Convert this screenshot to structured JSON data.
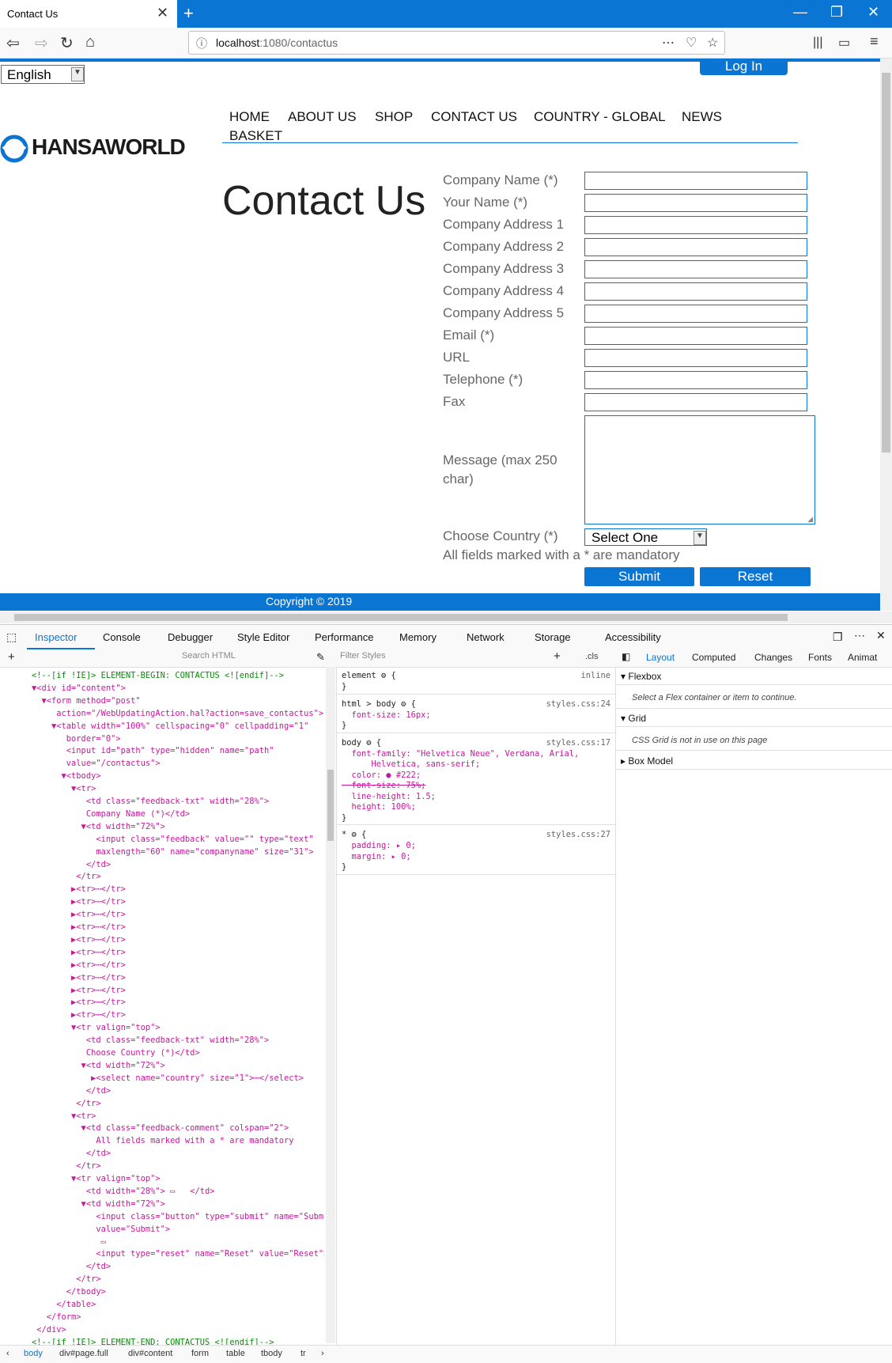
{
  "browser": {
    "tab_title": "Contact Us",
    "close_glyph": "✕",
    "new_tab_glyph": "+",
    "url_host": "localhost",
    "url_path": ":1080/contactus",
    "window_controls": [
      "—",
      "❐",
      "✕"
    ]
  },
  "page": {
    "language": "English",
    "login_label": "Log In",
    "logo_text": "HANSAWORLD",
    "menu": [
      "HOME",
      "ABOUT US",
      "SHOP",
      "CONTACT US",
      "COUNTRY - GLOBAL",
      "NEWS",
      "BASKET"
    ],
    "title": "Contact Us",
    "fields": [
      "Company Name (*)",
      "Your Name (*)",
      "Company Address 1",
      "Company Address 2",
      "Company Address 3",
      "Company Address 4",
      "Company Address 5",
      "Email (*)",
      "URL",
      "Telephone (*)",
      "Fax"
    ],
    "message_label_1": "Message (max 250",
    "message_label_2": "char)",
    "country_label": "Choose Country (*)",
    "country_value": "Select One",
    "mandatory_note": "All fields marked with a * are mandatory",
    "submit_label": "Submit",
    "reset_label": "Reset",
    "copyright": "Copyright © 2019",
    "accent_color": "#0a75d2"
  },
  "devtools": {
    "tabs": [
      "Inspector",
      "Console",
      "Debugger",
      "Style Editor",
      "Performance",
      "Memory",
      "Network",
      "Storage",
      "Accessibility"
    ],
    "search_html_placeholder": "Search HTML",
    "filter_styles_placeholder": "Filter Styles",
    "cls_label": ".cls",
    "layout_tabs": [
      "Layout",
      "Computed",
      "Changes",
      "Fonts",
      "Animat"
    ],
    "flexbox_heading": "Flexbox",
    "flexbox_note": "Select a Flex container or item to continue.",
    "grid_heading": "Grid",
    "grid_note": "CSS Grid is not in use on this page",
    "box_model_heading": "Box Model",
    "breadcrumb": [
      "body",
      "div#page.full",
      "div#content",
      "form",
      "table",
      "tbody",
      "tr"
    ],
    "markup_lines": [
      "<!--[if !IE]> ELEMENT-BEGIN: CONTACTUS <![endif]-->",
      "▼<div id=\"content\">",
      "  ▼<form method=\"post\"",
      "     action=\"/WebUpdatingAction.hal?action=save_contactus\">",
      "    ▼<table width=\"100%\" cellspacing=\"0\" cellpadding=\"1\"",
      "       border=\"0\">",
      "       <input id=\"path\" type=\"hidden\" name=\"path\"",
      "       value=\"/contactus\">",
      "      ▼<tbody>",
      "        ▼<tr>",
      "           <td class=\"feedback-txt\" width=\"28%\">",
      "           Company Name (*)</td>",
      "          ▼<td width=\"72%\">",
      "             <input class=\"feedback\" value=\"\" type=\"text\"",
      "             maxlength=\"60\" name=\"companyname\" size=\"31\">",
      "           </td>",
      "         </tr>",
      "        ▶<tr>⋯</tr>",
      "        ▶<tr>⋯</tr>",
      "        ▶<tr>⋯</tr>",
      "        ▶<tr>⋯</tr>",
      "        ▶<tr>⋯</tr>",
      "        ▶<tr>⋯</tr>",
      "        ▶<tr>⋯</tr>",
      "        ▶<tr>⋯</tr>",
      "        ▶<tr>⋯</tr>",
      "        ▶<tr>⋯</tr>",
      "        ▶<tr>⋯</tr>",
      "        ▼<tr valign=\"top\">",
      "           <td class=\"feedback-txt\" width=\"28%\">",
      "           Choose Country (*)</td>",
      "          ▼<td width=\"72%\">",
      "            ▶<select name=\"country\" size=\"1\">⋯</select>",
      "           </td>",
      "         </tr>",
      "        ▼<tr>",
      "          ▼<td class=\"feedback-comment\" colspan=\"2\">",
      "             All fields marked with a * are mandatory",
      "           </td>",
      "         </tr>",
      "        ▼<tr valign=\"top\">",
      "           <td width=\"28%\"> ▭   </td>",
      "          ▼<td width=\"72%\">",
      "             <input class=\"button\" type=\"submit\" name=\"Submit\"",
      "             value=\"Submit\">",
      "              ▭",
      "             <input type=\"reset\" name=\"Reset\" value=\"Reset\">",
      "           </td>",
      "         </tr>",
      "       </tbody>",
      "     </table>",
      "   </form>",
      " </div>",
      "<!--[if !IE]> ELEMENT-END: CONTACTUS <![endif]-->"
    ],
    "rules": [
      {
        "selector": "element ⚙ {",
        "source": "inline",
        "lines": [
          "}"
        ]
      },
      {
        "selector": "html > body ⚙ {",
        "source": "styles.css:24",
        "lines": [
          "  font-size: 16px;",
          "}"
        ]
      },
      {
        "selector": "body ⚙ {",
        "source": "styles.css:17",
        "lines": [
          "  font-family: \"Helvetica Neue\", Verdana, Arial,",
          "      Helvetica, sans-serif;",
          "  color: ● #222;",
          "  font-size: 75%;",
          "  line-height: 1.5;",
          "  height: 100%;",
          "}"
        ]
      },
      {
        "selector": "* ⚙ {",
        "source": "styles.css:27",
        "lines": [
          "  padding: ▸ 0;",
          "  margin: ▸ 0;",
          "}"
        ]
      }
    ]
  }
}
